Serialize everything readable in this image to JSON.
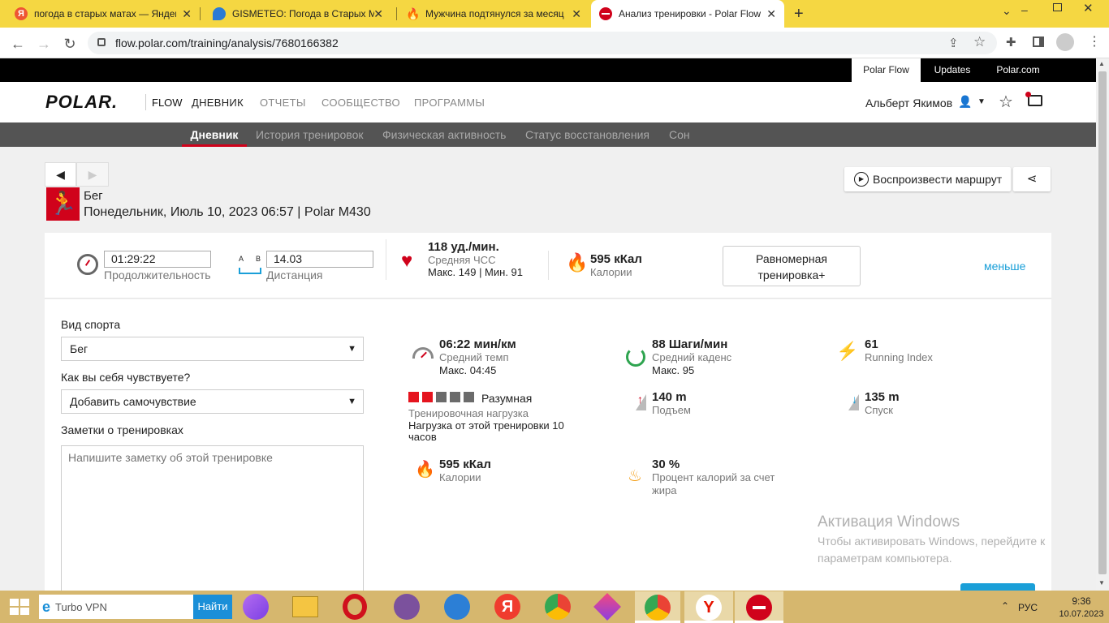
{
  "browser": {
    "tabs": [
      {
        "title": "погода в старых матах — Яндекс"
      },
      {
        "title": "GISMETEO: Погода в Старых Матах"
      },
      {
        "title": "Мужчина подтянулся за месяц"
      },
      {
        "title": "Анализ тренировки - Polar Flow"
      }
    ],
    "new_tab": "+",
    "url": "flow.polar.com/training/analysis/7680166382",
    "win_min": "⌄",
    "win_restore": "–"
  },
  "topstrip": {
    "links": [
      "Polar Flow",
      "Updates",
      "Polar.com"
    ]
  },
  "header": {
    "logo": "POLAR.",
    "flow": "FLOW",
    "nav": [
      "ДНЕВНИК",
      "ОТЧЕТЫ",
      "СООБЩЕСТВО",
      "ПРОГРАММЫ"
    ],
    "user": "Альберт Якимов"
  },
  "subnav": {
    "items": [
      "Дневник",
      "История тренировок",
      "Физическая активность",
      "Статус восстановления",
      "Сон"
    ]
  },
  "session": {
    "sport_name": "Бег",
    "datetime_device": "Понедельник, Июль 10, 2023 06:57 | Polar M430",
    "play_route": "Воспроизвести маршрут"
  },
  "summary": {
    "duration_value": "01:29:22",
    "duration_label": "Продолжительность",
    "ab_a": "A",
    "ab_b": "B",
    "distance_value": "14.03",
    "distance_label": "Дистанция",
    "hr_value": "118 уд./мин.",
    "hr_label": "Средняя ЧСС",
    "hr_maxmin": "Макс. 149  |  Мин. 91",
    "cal_value": "595 кКал",
    "cal_label": "Калории",
    "benefit": "Равномерная тренировка+",
    "less": "меньше"
  },
  "form": {
    "sport_label": "Вид спорта",
    "sport_value": "Бег",
    "feeling_label": "Как вы себя чувствуете?",
    "feeling_value": "Добавить самочувствие",
    "notes_label": "Заметки о тренировках",
    "notes_placeholder": "Напишите заметку об этой тренировке"
  },
  "details": {
    "pace_value": "06:22 мин/км",
    "pace_label": "Средний темп",
    "pace_max": "Макс. 04:45",
    "cadence_value": "88 Шаги/мин",
    "cadence_label": "Средний каденс",
    "cadence_max": "Макс. 95",
    "ri_value": "61",
    "ri_label": "Running Index",
    "load_level": "Разумная",
    "load_label": "Тренировочная нагрузка",
    "load_desc": "Нагрузка от этой тренировки 10 часов",
    "load_filled": 2,
    "load_total": 5,
    "ascent_value": "140 m",
    "ascent_label": "Подъем",
    "descent_value": "135 m",
    "descent_label": "Спуск",
    "calories_value": "595 кКал",
    "calories_label": "Калории",
    "fat_value": "30 %",
    "fat_label": "Процент калорий за счет жира"
  },
  "watermark": {
    "title": "Активация Windows",
    "line": "Чтобы активировать Windows, перейдите к параметрам компьютера."
  },
  "taskbar": {
    "search_text": "Turbo VPN",
    "search_button": "Найти",
    "lang": "РУС",
    "time": "9:36",
    "date": "10.07.2023"
  },
  "colors": {
    "polar_red": "#d0021b",
    "accent_blue": "#1a9fd8",
    "tabbar": "#f5d742",
    "taskbar": "#d6b76e"
  }
}
